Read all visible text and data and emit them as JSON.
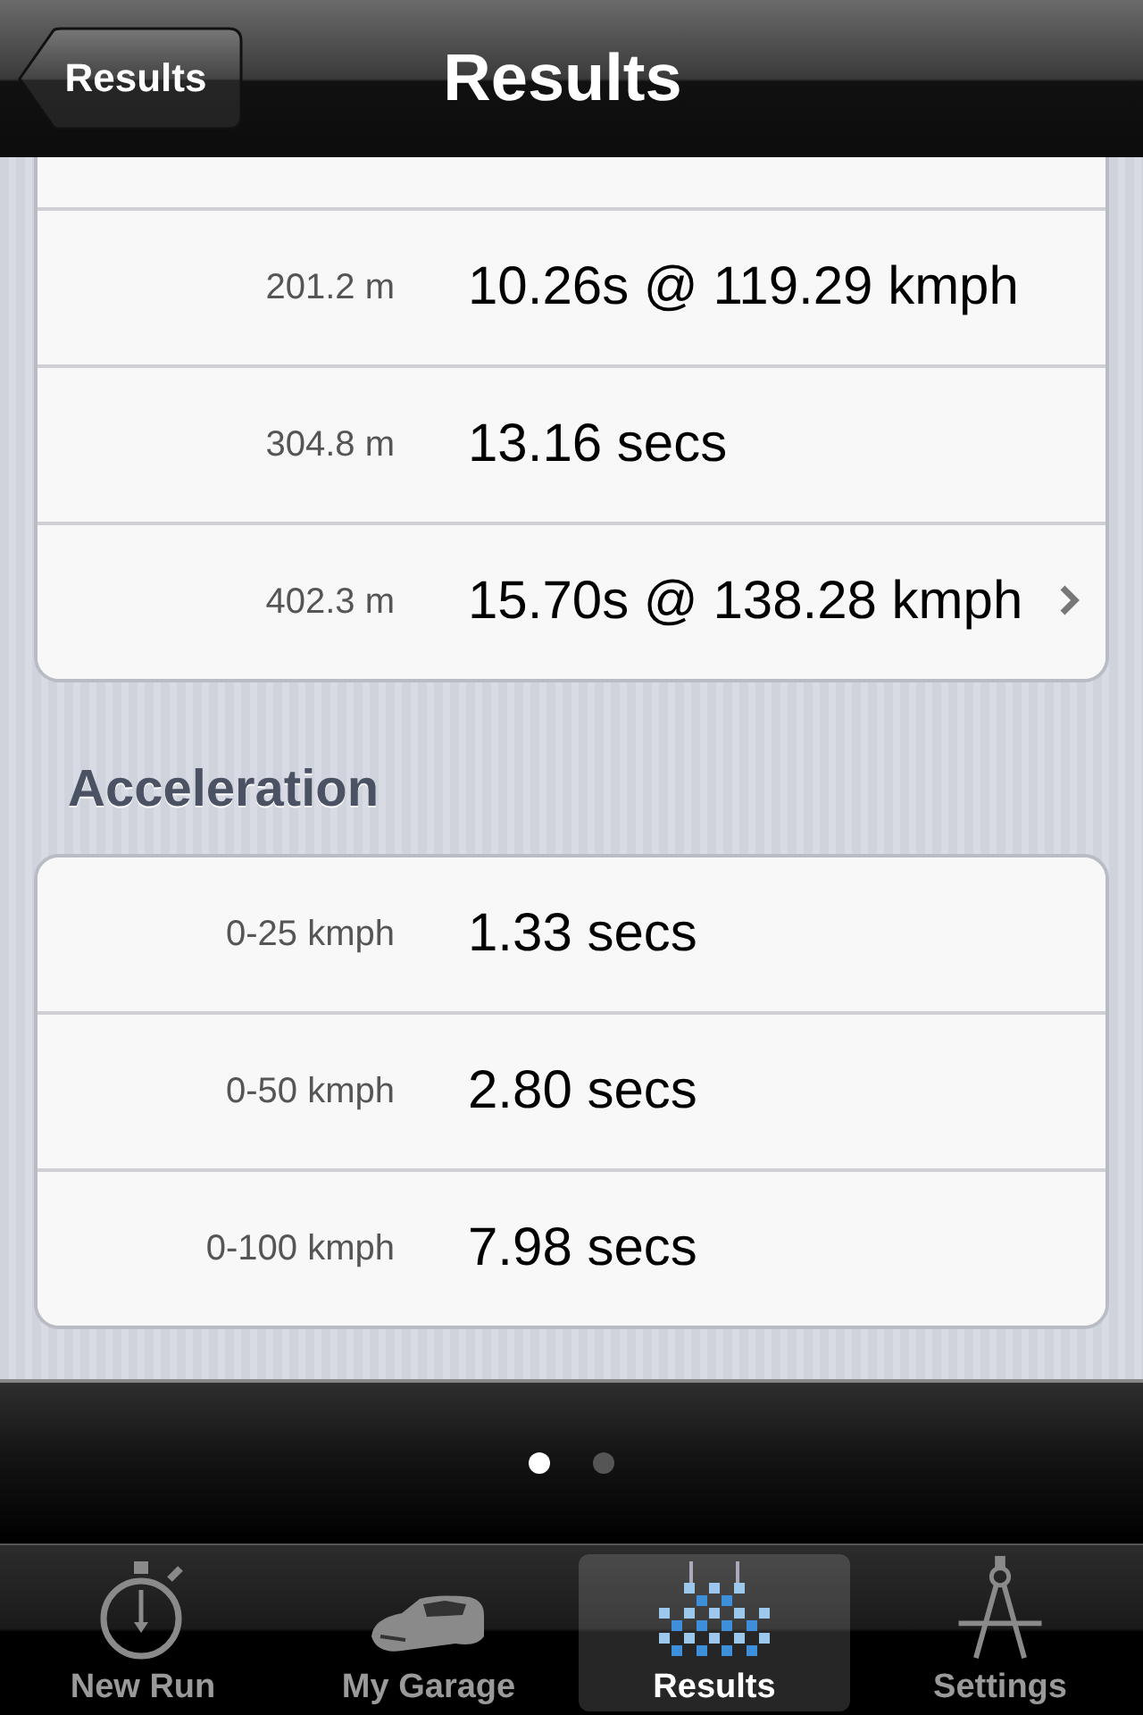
{
  "nav_bar": {
    "back_button": "Results",
    "title": "Results"
  },
  "sections": [
    {
      "rows": [
        {
          "label": "201.2 m",
          "value": "10.26s @ 119.29 kmph",
          "disclosure": false
        },
        {
          "label": "304.8 m",
          "value": "13.16 secs",
          "disclosure": false
        },
        {
          "label": "402.3 m",
          "value": "15.70s @ 138.28 kmph",
          "disclosure": true
        }
      ]
    },
    {
      "header": "Acceleration",
      "rows": [
        {
          "label": "0-25 kmph",
          "value": "1.33 secs",
          "disclosure": false
        },
        {
          "label": "0-50 kmph",
          "value": "2.80 secs",
          "disclosure": false
        },
        {
          "label": "0-100 kmph",
          "value": "7.98 secs",
          "disclosure": false
        }
      ]
    }
  ],
  "page_dots": [
    {
      "selected": true
    },
    {
      "selected": false
    }
  ],
  "tab_bar": [
    {
      "kind": "stopwatch",
      "label": "New Run",
      "selected": false
    },
    {
      "kind": "car",
      "label": "My Garage",
      "selected": false
    },
    {
      "kind": "flags",
      "label": "Results",
      "selected": true
    },
    {
      "kind": "compass",
      "label": "Settings",
      "selected": false
    }
  ]
}
